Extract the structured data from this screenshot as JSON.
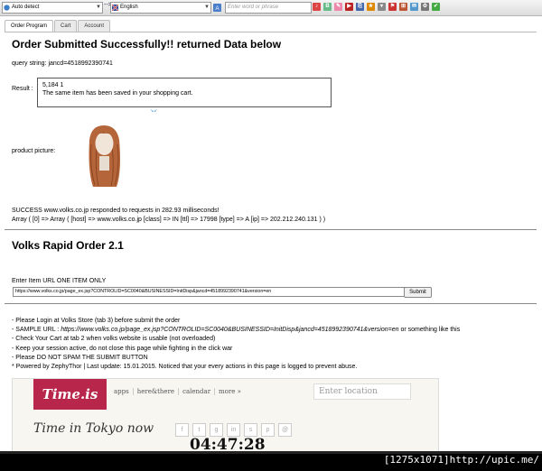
{
  "translate_bar": {
    "source_lang": "Auto detect",
    "swap_label": "-->",
    "target_lang": "English",
    "input_placeholder": "Enter word or phrase"
  },
  "tabs": [
    {
      "label": "Order Program"
    },
    {
      "label": "Cart"
    },
    {
      "label": "Account"
    }
  ],
  "main": {
    "heading": "Order Submitted Successfully!! returned Data below",
    "query_string": "query string: jancd=4518992390741",
    "result_label": "Result :",
    "result_line1": "5,184 1",
    "result_line2": "The same item has been saved in your shopping cart.",
    "picture_label": "product picture:",
    "success_line": "SUCCESS www.volks.co.jp responded to requests in 282.93 milliseconds!",
    "array_line": "Array ( [0] => Array ( [host] => www.volks.co.jp [class] => IN [ttl] => 17998 [type] => A [ip] => 202.212.240.131 ) )",
    "rapid_title": "Volks Rapid Order 2.1",
    "url_label": "Enter Item URL ONE ITEM ONLY",
    "url_value": "https://www.volks.co.jp/page_ex.jsp?CONTROLID=SC0040&BUSINESSID=InitDisp&jancd=4518992390741&version=en",
    "submit_label": "Submit",
    "notes": [
      "- Please Login at Volks Store (tab 3) before submit the order",
      "- SAMPLE URL : ",
      "- Check Your Cart at tab 2 when volks website is usable (not overloaded)",
      "- Keep your session active, do not close this page while fighting in the click war",
      "- Please DO NOT SPAM THE SUBMIT BUTTON",
      "* Powered by ZephyThor | Last update: 15.01.2015. Noticed that your every actions in this page is logged to prevent abuse."
    ],
    "sample_url": "https://www.volks.co.jp/page_ex.jsp?CONTROLID=SC0040&BUSINESSID=InitDisp&jancd=4518992390741&version=en",
    "sample_suffix": " or something like this"
  },
  "timeis": {
    "logo": "Time.is",
    "nav": [
      "apps",
      "here&there",
      "calendar",
      "more »"
    ],
    "location_placeholder": "Enter location",
    "city": "Time in Tokyo now",
    "clock": "04:47:28"
  },
  "watermark": "[1275x1071]http://upic.me/",
  "colors": {
    "timeis_brand": "#b8274b"
  }
}
